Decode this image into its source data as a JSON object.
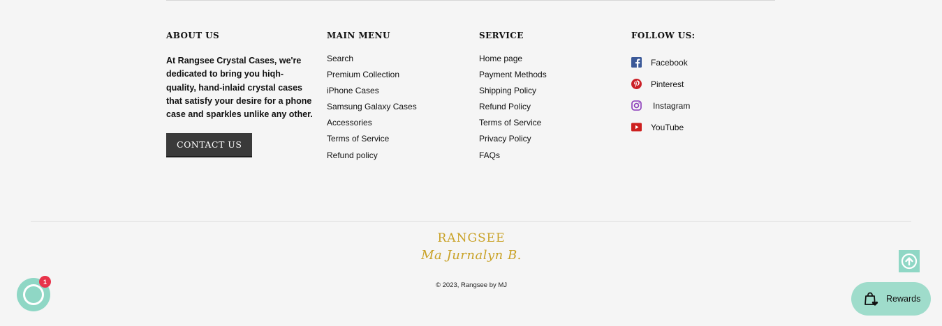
{
  "about": {
    "heading": "ABOUT US",
    "text": "At Rangsee Crystal Cases, we're dedicated to bring you hiqh-quality, hand-inlaid crystal cases that satisfy your desire for a phone case and sparkles unlike any other.",
    "button_label": "CONTACT US"
  },
  "main_menu": {
    "heading": "MAIN MENU",
    "items": [
      "Search",
      "Premium Collection",
      "iPhone Cases",
      "Samsung Galaxy Cases",
      "Accessories",
      "Terms of Service",
      "Refund policy"
    ]
  },
  "service": {
    "heading": "SERVICE",
    "items": [
      "Home page",
      "Payment Methods",
      "Shipping Policy",
      "Refund Policy",
      "Terms of Service",
      "Privacy Policy",
      "FAQs"
    ]
  },
  "follow": {
    "heading": "FOLLOW US:",
    "items": [
      {
        "label": "Facebook",
        "icon": "facebook-icon",
        "color": "#3b5998"
      },
      {
        "label": "Pinterest",
        "icon": "pinterest-icon",
        "color": "#cb2027"
      },
      {
        "label": "Instagram",
        "icon": "instagram-icon",
        "color": "#8a3ab9"
      },
      {
        "label": "YouTube",
        "icon": "youtube-icon",
        "color": "#cd201f"
      }
    ]
  },
  "brand": {
    "name": "RANGSEE",
    "signature": "Ma Jurnalyn B.",
    "color": "#c9a227"
  },
  "copyright": "© 2023, Rangsee by MJ",
  "chat": {
    "badge_count": "1",
    "color": "#8fd7c5"
  },
  "rewards": {
    "label": "Rewards",
    "color": "#9fdccb"
  }
}
